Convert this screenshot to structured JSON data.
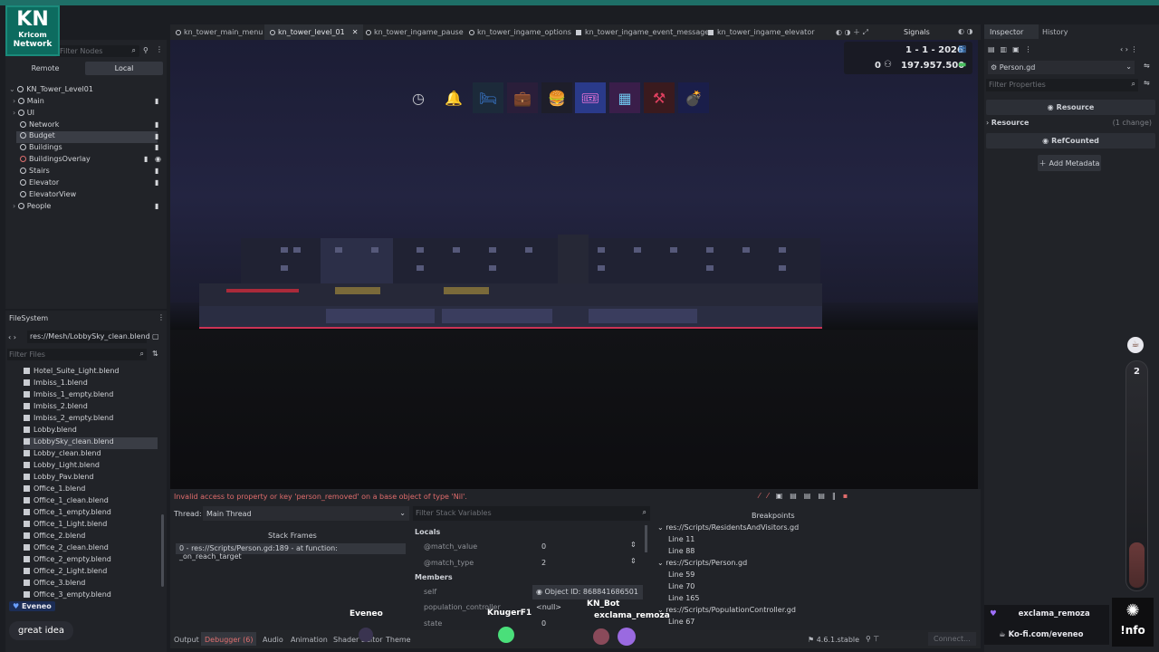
{
  "logo": {
    "initials": "KN",
    "line1": "Kricom",
    "line2": "Network"
  },
  "scene_panel": {
    "search_placeholder": "Filter Nodes",
    "tab_remote": "Remote",
    "tab_local": "Local",
    "root": "KN_Tower_Level01",
    "nodes": [
      "Main",
      "UI",
      "Network",
      "Budget",
      "Buildings",
      "BuildingsOverlay",
      "Stairs",
      "Elevator",
      "ElevatorView",
      "People"
    ]
  },
  "filesystem": {
    "title": "FileSystem",
    "path": "res://Mesh/LobbySky_clean.blend",
    "filter_placeholder": "Filter Files",
    "files": [
      "Hotel_Suite_Light.blend",
      "Imbiss_1.blend",
      "Imbiss_1_empty.blend",
      "Imbiss_2.blend",
      "Imbiss_2_empty.blend",
      "Lobby.blend",
      "LobbySky_clean.blend",
      "Lobby_clean.blend",
      "Lobby_Light.blend",
      "Lobby_Pav.blend",
      "Office_1.blend",
      "Office_1_clean.blend",
      "Office_1_empty.blend",
      "Office_1_Light.blend",
      "Office_2.blend",
      "Office_2_clean.blend",
      "Office_2_empty.blend",
      "Office_2_Light.blend",
      "Office_3.blend",
      "Office_3_empty.blend"
    ]
  },
  "tabs": [
    "kn_tower_main_menu",
    "kn_tower_level_01",
    "kn_tower_ingame_pause",
    "kn_tower_ingame_options",
    "kn_tower_ingame_event_message",
    "kn_tower_ingame_elevator"
  ],
  "signals_tab": "Signals",
  "inspector": {
    "tab_inspector": "Inspector",
    "tab_history": "History",
    "resource_name": "Person.gd",
    "filter_placeholder": "Filter Properties",
    "section_resource": "Resource",
    "subsection_resource": "Resource",
    "changes": "(1 change)",
    "section_refcounted": "RefCounted",
    "add_metadata": "Add Metadata"
  },
  "game_hud": {
    "date": "1 - 1 - 2026",
    "population": "0",
    "money": "197.957.500"
  },
  "debugger": {
    "error": "Invalid access to property or key 'person_removed' on a base object of type 'Nil'.",
    "thread_label": "Thread:",
    "thread_value": "Main Thread",
    "filter_stack": "Filter Stack Variables",
    "stack_frames_title": "Stack Frames",
    "stack_frame": "0 - res://Scripts/Person.gd:189 - at function: _on_reach_target",
    "locals": "Locals",
    "vars": [
      {
        "name": "@match_value",
        "value": "0"
      },
      {
        "name": "@match_type",
        "value": "2"
      }
    ],
    "members": "Members",
    "member_vars": [
      {
        "name": "self",
        "value": "Object ID: 868841686501"
      },
      {
        "name": "population_controller",
        "value": "<null>"
      },
      {
        "name": "state",
        "value": "0"
      }
    ],
    "breakpoints_title": "Breakpoints",
    "breakpoints": [
      {
        "file": "res://Scripts/ResidentsAndVisitors.gd",
        "lines": [
          "Line 11",
          "Line 88"
        ]
      },
      {
        "file": "res://Scripts/Person.gd",
        "lines": [
          "Line 59",
          "Line 70",
          "Line 165"
        ]
      },
      {
        "file": "res://Scripts/PopulationController.gd",
        "lines": [
          "Line 67"
        ]
      }
    ]
  },
  "bottom_tabs": [
    "Output",
    "Debugger (6)",
    "Audio",
    "Animation",
    "Shader Editor",
    "Theme"
  ],
  "version": "4.6.1.stable",
  "connect": "Connect...",
  "overlay": {
    "chat_user": "Eveneo",
    "chat_message": "great idea",
    "names": [
      "Eveneo",
      "KnugerF1",
      "KN_Bot",
      "exclama_remoza"
    ],
    "kofi_user": "exclama_remoza",
    "kofi_link": "Ko-fi.com/eveneo",
    "counter": "2",
    "info": "!nfo"
  }
}
